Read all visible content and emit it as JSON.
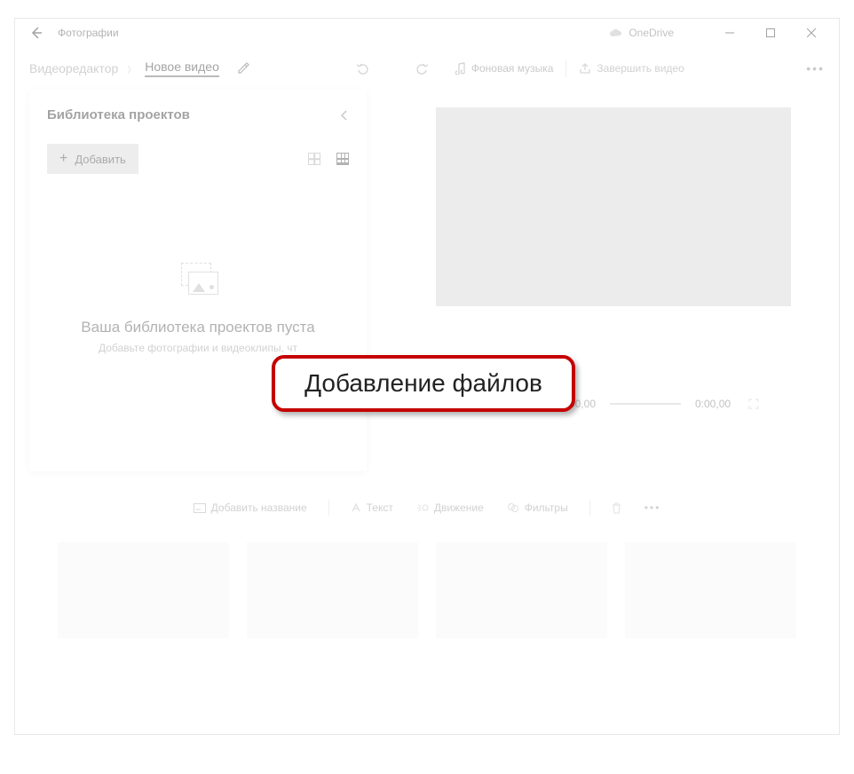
{
  "titlebar": {
    "title": "Фотографии",
    "onedrive": "OneDrive"
  },
  "cmdbar": {
    "editor": "Видеоредактор",
    "title": "Новое видео",
    "music": "Фоновая музыка",
    "finish": "Завершить видео"
  },
  "sidebar": {
    "title": "Библиотека проектов",
    "add": "Добавить",
    "empty_title": "Ваша библиотека проектов пуста",
    "empty_sub": "Добавьте фотографии и видеоклипы, чт"
  },
  "preview": {
    "time_current": "0:00,00",
    "time_total": "0:00,00"
  },
  "bottom": {
    "add_title": "Добавить название",
    "text": "Текст",
    "motion": "Движение",
    "filters": "Фильтры"
  },
  "callout": {
    "text": "Добавление файлов"
  }
}
